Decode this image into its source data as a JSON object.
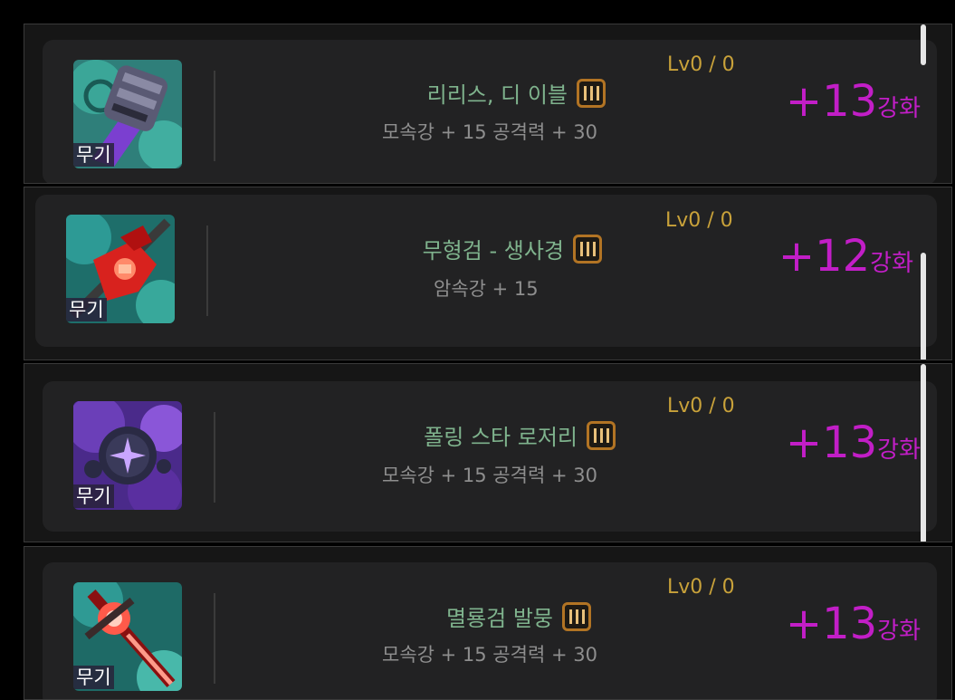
{
  "items": [
    {
      "slot": "무기",
      "name": "리리스, 디 이블",
      "stats": "모속강 + 15 공격력 + 30",
      "level": "Lv0 / 0",
      "upgrade_value": "+13",
      "upgrade_suffix": "강화",
      "icon": "gauntlet-icon",
      "colors": {
        "bg": "#3fb0a0",
        "main": "#5a5a74",
        "accent": "#7b3fd0"
      }
    },
    {
      "slot": "무기",
      "name": "무형검 - 생사경",
      "stats": "암속강 + 15",
      "level": "Lv0 / 0",
      "upgrade_value": "+12",
      "upgrade_suffix": "강화",
      "icon": "red-sword-icon",
      "colors": {
        "bg": "#2f9f9a",
        "main": "#d8221e",
        "accent": "#3a3a3a"
      }
    },
    {
      "slot": "무기",
      "name": "폴링 스타 로저리",
      "stats": "모속강 + 15 공격력 + 30",
      "level": "Lv0 / 0",
      "upgrade_value": "+13",
      "upgrade_suffix": "강화",
      "icon": "star-rosary-icon",
      "colors": {
        "bg": "#6b3fb8",
        "main": "#2a2a44",
        "accent": "#c9a6ff"
      }
    },
    {
      "slot": "무기",
      "name": "멸룡검 발뭉",
      "stats": "모속강 + 15 공격력 + 30",
      "level": "Lv0 / 0",
      "upgrade_value": "+13",
      "upgrade_suffix": "강화",
      "icon": "dragon-sword-icon",
      "colors": {
        "bg": "#2f9a94",
        "main": "#ff5a4a",
        "accent": "#8a1010"
      }
    }
  ],
  "colors": {
    "name": "#7fb38d",
    "stats": "#8e8e8e",
    "level": "#c9a23a",
    "upgrade": "#c21ec7",
    "tier_border": "#b27424"
  }
}
